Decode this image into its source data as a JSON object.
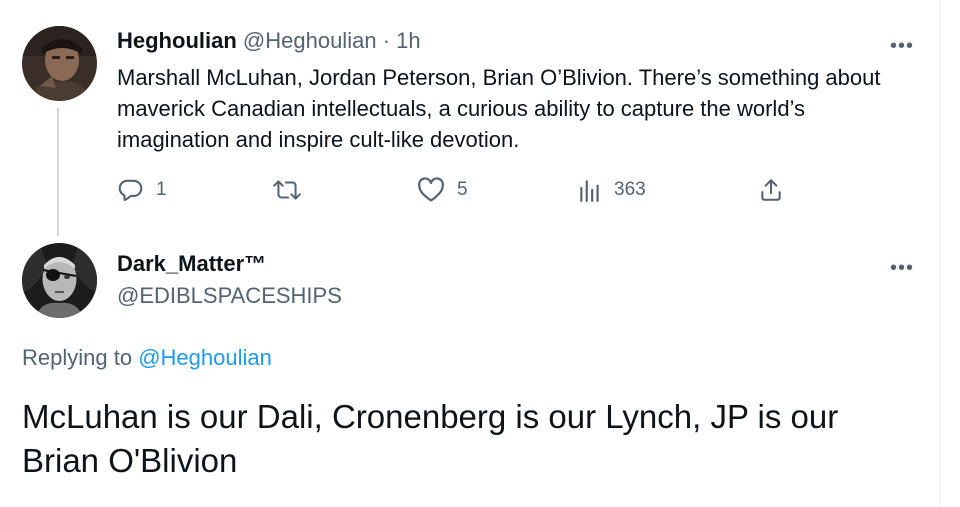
{
  "parent_tweet": {
    "display_name": "Heghoulian",
    "handle": "@Heghoulian",
    "separator": "·",
    "time": "1h",
    "text": "Marshall McLuhan, Jordan Peterson, Brian O’Blivion. There’s something about maverick Canadian intellectuals, a curious ability to capture the world’s imagination and inspire cult-like devotion.",
    "more": "•••",
    "actions": {
      "replies": "1",
      "retweets": "",
      "likes": "5",
      "views": "363"
    }
  },
  "reply_tweet": {
    "display_name": "Dark_Matter™",
    "handle": "@EDIBLSPACESHIPS",
    "more": "•••",
    "replying_prefix": "Replying to",
    "replying_to": "@Heghoulian",
    "text": "McLuhan is our Dali, Cronenberg is our Lynch, JP is our Brian O'Blivion"
  },
  "icons": [
    "reply-icon",
    "retweet-icon",
    "like-icon",
    "views-icon",
    "share-icon",
    "more-icon"
  ],
  "colors": {
    "text": "#0f1419",
    "muted": "#536471",
    "link": "#1d9bf0",
    "thread_line": "#cfd9de"
  }
}
